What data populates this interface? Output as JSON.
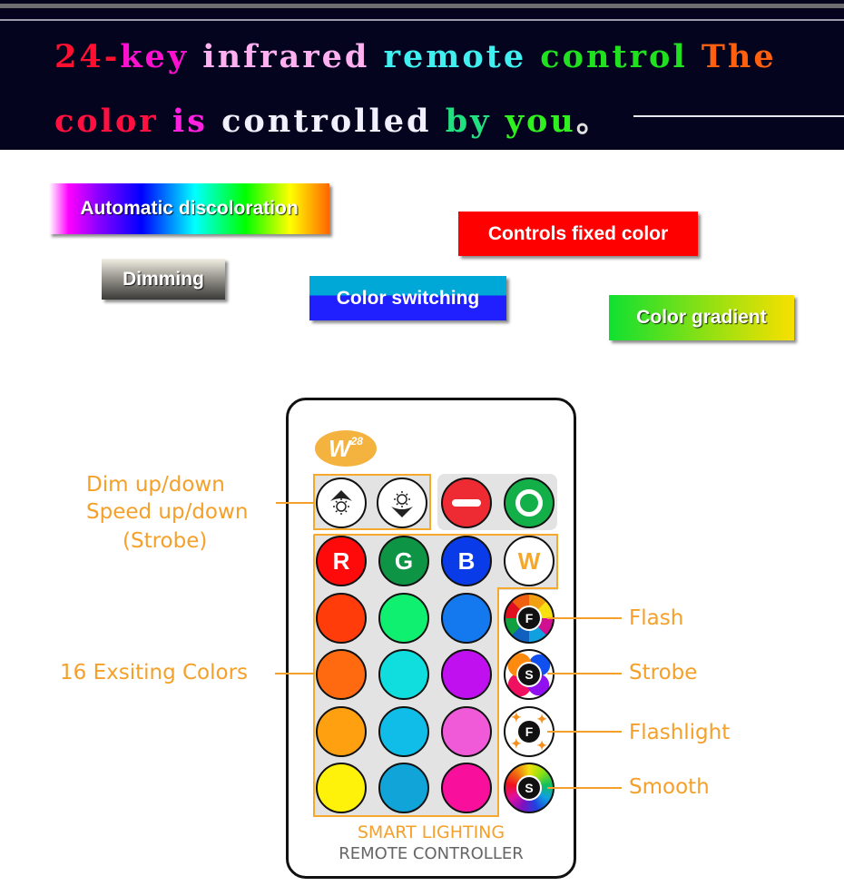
{
  "headline": {
    "line1": [
      {
        "text": "24-",
        "color": "#ff1030"
      },
      {
        "text": "key ",
        "color": "#ff10d0"
      },
      {
        "text": "infrared ",
        "color": "#ffb0f0"
      },
      {
        "text": "remote ",
        "color": "#40f0f0"
      },
      {
        "text": "control ",
        "color": "#20e020"
      },
      {
        "text": "The",
        "color": "#ff6010"
      }
    ],
    "line2": [
      {
        "text": "color ",
        "color": "#ff1040"
      },
      {
        "text": "is ",
        "color": "#ff20e0"
      },
      {
        "text": "controlled ",
        "color": "#f0f0ff"
      },
      {
        "text": "by ",
        "color": "#20e080"
      },
      {
        "text": "you",
        "color": "#30f020"
      },
      {
        "text": "。",
        "color": "#e0e0e0"
      }
    ]
  },
  "tags": {
    "automatic": "Automatic discoloration",
    "dimming": "Dimming",
    "switching": "Color switching",
    "fixed": "Controls fixed color",
    "gradient": "Color gradient"
  },
  "remote": {
    "logo": {
      "main": "W",
      "sup": "28"
    },
    "top_buttons": [
      {
        "name": "dim-up",
        "icon": "brightness-up-icon"
      },
      {
        "name": "dim-down",
        "icon": "brightness-down-icon"
      },
      {
        "name": "off",
        "icon": "minus-icon",
        "color": "#ee2a32"
      },
      {
        "name": "on",
        "icon": "circle-icon",
        "color": "#13b04a"
      }
    ],
    "rgbw": [
      {
        "label": "R",
        "color": "#ff0a0a",
        "text": "#ffffff"
      },
      {
        "label": "G",
        "color": "#0d9444",
        "text": "#ffffff"
      },
      {
        "label": "B",
        "color": "#0a3be8",
        "text": "#ffffff"
      },
      {
        "label": "W",
        "color": "#ffffff",
        "text": "#f4a82c"
      }
    ],
    "color_grid": [
      [
        "#ff3c0a",
        "#10f070",
        "#1478ee"
      ],
      [
        "#ff6a10",
        "#10dede",
        "#c010f0"
      ],
      [
        "#ffa010",
        "#10bce8",
        "#f05ad8"
      ],
      [
        "#fff20a",
        "#10a4d8",
        "#f8109c"
      ]
    ],
    "mode_buttons": [
      {
        "label": "F",
        "mode": "flash"
      },
      {
        "label": "S",
        "mode": "strobe"
      },
      {
        "label": "F",
        "mode": "flashlight"
      },
      {
        "label": "S",
        "mode": "smooth"
      }
    ],
    "footer_line1": "SMART LIGHTING",
    "footer_line2": "REMOTE CONTROLLER"
  },
  "callouts": {
    "dim_line1": "Dim up/down",
    "dim_line2": "Speed up/down",
    "dim_line3": "(Strobe)",
    "colors": "16 Exsiting Colors",
    "flash": "Flash",
    "strobe": "Strobe",
    "flashlight": "Flashlight",
    "smooth": "Smooth"
  }
}
